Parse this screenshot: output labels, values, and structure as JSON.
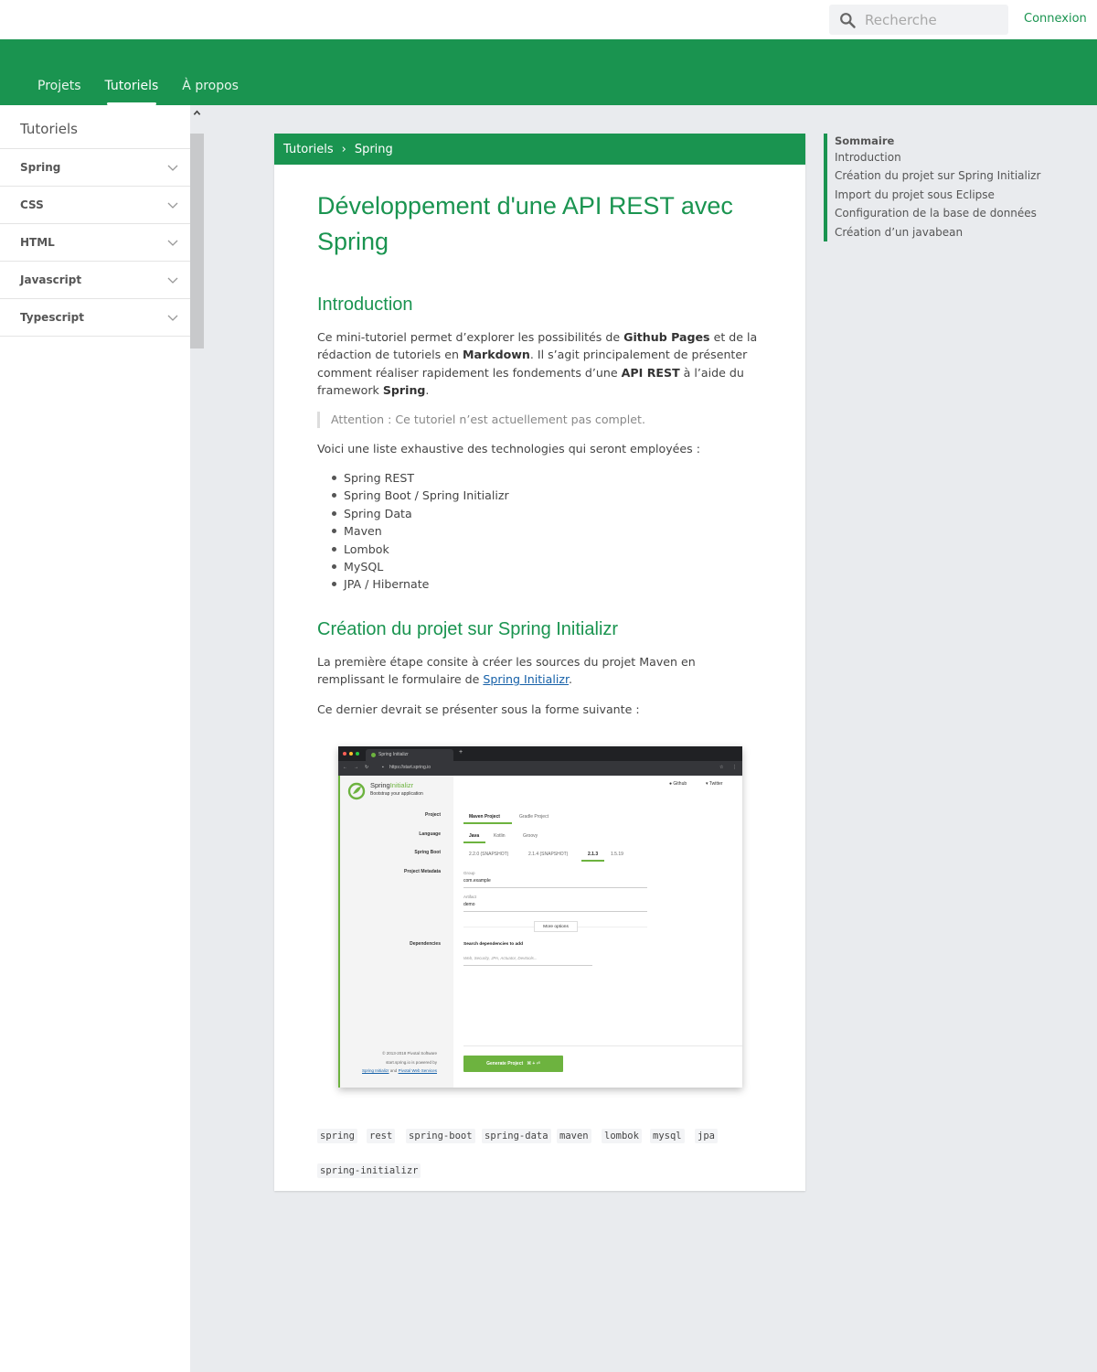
{
  "header": {
    "search_placeholder": "Recherche",
    "login_label": "Connexion"
  },
  "nav": {
    "items": [
      "Projets",
      "Tutoriels",
      "À propos"
    ],
    "active": "Tutoriels"
  },
  "sidebar": {
    "title": "Tutoriels",
    "items": [
      "Spring",
      "CSS",
      "HTML",
      "Javascript",
      "Typescript"
    ]
  },
  "breadcrumb": {
    "root": "Tutoriels",
    "separator": "›",
    "current": "Spring"
  },
  "article": {
    "title": "Développement d'une API REST avec Spring",
    "intro_heading": "Introduction",
    "intro_p": {
      "t1": "Ce mini-tutoriel permet d’explorer les possibilités de ",
      "b1": "Github Pages",
      "t2": " et de la rédaction de tutoriels en ",
      "b2": "Markdown",
      "t3": ". Il s’agit principalement de présenter comment réaliser rapidement les fondements d’une ",
      "b3": "API REST",
      "t4": " à l’aide du framework ",
      "b4": "Spring",
      "t5": "."
    },
    "quote": "Attention : Ce tutoriel n’est actuellement pas complet.",
    "list_intro": "Voici une liste exhaustive des technologies qui seront employées :",
    "technologies": [
      "Spring REST",
      "Spring Boot / Spring Initializr",
      "Spring Data",
      "Maven",
      "Lombok",
      "MySQL",
      "JPA / Hibernate"
    ],
    "section2_heading": "Création du projet sur Spring Initializr",
    "section2_p1": {
      "t1": "La première étape consite à créer les sources du projet Maven en remplissant le formulaire de ",
      "link": "Spring Initializr",
      "t2": "."
    },
    "section2_p2": "Ce dernier devrait se présenter sous la forme suivante :",
    "tags": [
      "spring",
      "rest",
      "spring-boot",
      "spring-data",
      "maven",
      "lombok",
      "mysql",
      "jpa",
      "spring-initializr"
    ]
  },
  "toc": {
    "title": "Sommaire",
    "items": [
      "Introduction",
      "Création du projet sur Spring Initializr",
      "Import du projet sous Eclipse",
      "Configuration de la base de données",
      "Création d’un javabean"
    ]
  },
  "screenshot": {
    "tab_title": "Spring Initializr",
    "url": "https://start.spring.io",
    "brand_a": "Spring",
    "brand_b": "Initializr",
    "tagline": "Bootstrap your application",
    "github": "Github",
    "twitter": "Twitter",
    "labels": {
      "project": "Project",
      "language": "Language",
      "boot": "Spring Boot",
      "metadata": "Project Metadata",
      "dependencies": "Dependencies"
    },
    "project_options": [
      "Maven Project",
      "Gradle Project"
    ],
    "language_options": [
      "Java",
      "Kotlin",
      "Groovy"
    ],
    "boot_options": [
      "2.2.0 (SNAPSHOT)",
      "2.1.4 (SNAPSHOT)",
      "2.1.3",
      "1.5.19"
    ],
    "group_label": "Group",
    "group_value": "com.example",
    "artifact_label": "Artifact",
    "artifact_value": "demo",
    "more_options": "More options",
    "deps_label": "Search dependencies to add",
    "deps_placeholder": "Web, Security, JPA, Actuator, Devtools...",
    "footer1": "© 2013-2018 Pivotal Software",
    "footer2": "start.spring.io is powered by",
    "footer3a": "Spring Initializr",
    "footer3b": "and",
    "footer3c": "Pivotal Web Services",
    "generate": "Generate Project",
    "shortcut": "⌘ + ⏎"
  }
}
